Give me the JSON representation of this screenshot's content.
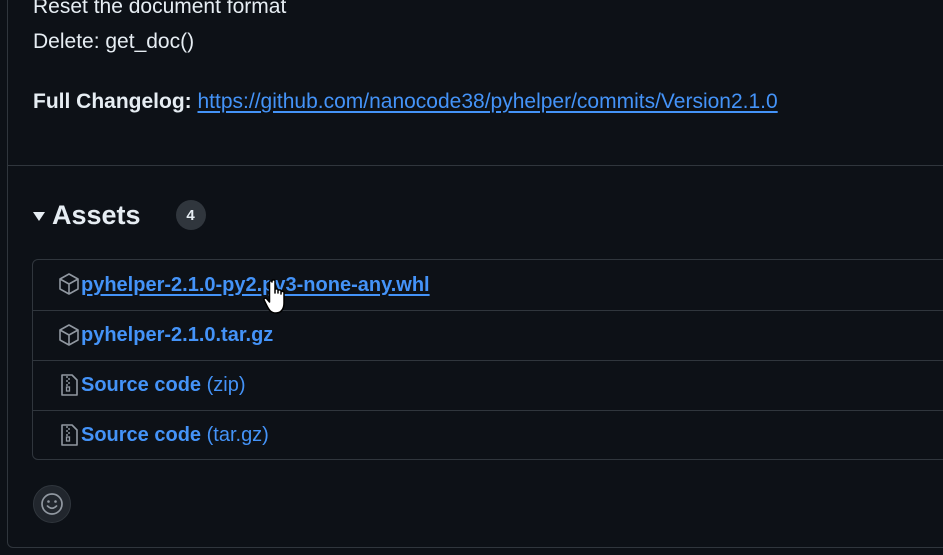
{
  "release_notes": {
    "lines": [
      "Reset the document format",
      "Delete: get_doc()"
    ],
    "changelog_label": "Full Changelog:",
    "changelog_url": "https://github.com/nanocode38/pyhelper/commits/Version2.1.0"
  },
  "assets": {
    "title": "Assets",
    "count": "4",
    "items": [
      {
        "name": "pyhelper-2.1.0-py2.py3-none-any.whl",
        "suffix": "",
        "icon": "package-icon"
      },
      {
        "name": "pyhelper-2.1.0.tar.gz",
        "suffix": "",
        "icon": "package-icon"
      },
      {
        "name": "Source code",
        "suffix": "(zip)",
        "icon": "file-zip-icon"
      },
      {
        "name": "Source code",
        "suffix": "(tar.gz)",
        "icon": "file-zip-icon"
      }
    ]
  },
  "colors": {
    "background": "#0d1117",
    "border": "#30363d",
    "link": "#4493f8",
    "text": "#e6edf3"
  },
  "reaction": {
    "icon": "smiley-icon"
  }
}
